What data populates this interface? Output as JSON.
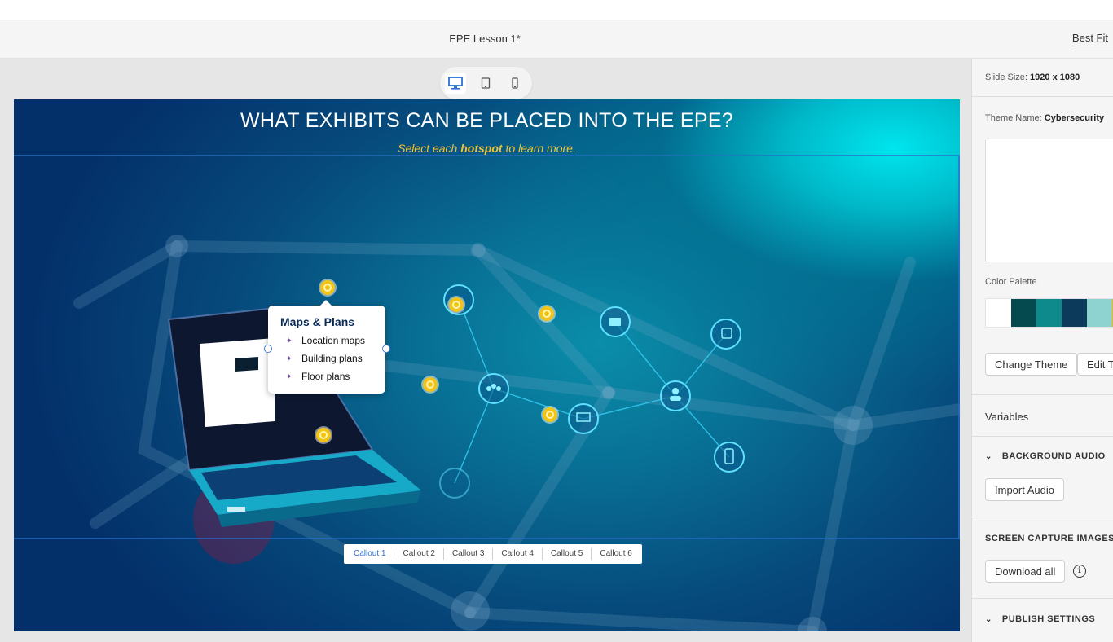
{
  "header": {
    "doc_title": "EPE Lesson 1*",
    "zoom_label": "Best Fit"
  },
  "device_switcher": {
    "options": [
      {
        "icon": "desktop-icon",
        "active": true
      },
      {
        "icon": "tablet-icon",
        "active": false
      },
      {
        "icon": "mobile-icon",
        "active": false
      }
    ]
  },
  "slide": {
    "title": "WHAT EXHIBITS CAN BE PLACED INTO THE EPE?",
    "subtitle_pre": "Select each ",
    "subtitle_bold": "hotspot",
    "subtitle_post": " to learn more.",
    "popup": {
      "title": "Maps & Plans",
      "items": [
        "Location maps",
        "Building plans",
        "Floor plans"
      ]
    },
    "callout_tabs": [
      "Callout 1",
      "Callout 2",
      "Callout 3",
      "Callout 4",
      "Callout 5",
      "Callout 6"
    ],
    "active_tab": "Callout 1"
  },
  "panel": {
    "slide_size_label": "Slide Size:",
    "slide_size_value": "1920 x 1080",
    "theme_name_label": "Theme Name:",
    "theme_name_value": "Cybersecurity",
    "color_palette_label": "Color Palette",
    "palette": [
      "#ffffff",
      "#054a4e",
      "#0e8a8c",
      "#0b3a5a",
      "#8fd3d0",
      "#f4b400"
    ],
    "change_theme": "Change Theme",
    "edit_theme": "Edit T",
    "variables": "Variables",
    "background_audio": "BACKGROUND AUDIO",
    "import_audio": "Import Audio",
    "screen_capture": "SCREEN CAPTURE IMAGES",
    "download_all": "Download all",
    "publish_settings": "PUBLISH SETTINGS"
  }
}
